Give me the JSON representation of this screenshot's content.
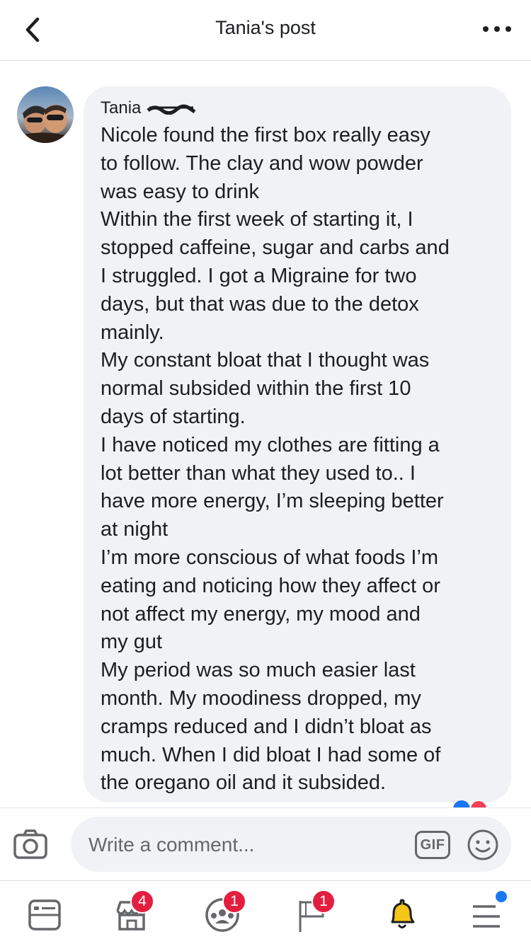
{
  "header": {
    "title": "Tania's post",
    "back_icon": "chevron-left-icon",
    "more_icon": "more-dots-icon"
  },
  "comment": {
    "author": "Tania",
    "lines": [
      "Nicole found the first box really easy",
      "to follow. The clay and wow powder",
      "was easy to drink",
      "Within the first week of starting it, I",
      "stopped caffeine, sugar and carbs and",
      "I struggled. I got a Migraine for two",
      "days, but that was due to the detox",
      "mainly.",
      "My constant bloat that I thought was",
      "normal subsided within the first 10",
      "days of starting.",
      "I have noticed my clothes are fitting a",
      "lot better than what they used to.. I",
      "have more energy, I’m sleeping better",
      "at night",
      "I’m more conscious of what foods I’m",
      "eating and noticing how they affect or",
      "not affect my energy, my mood and",
      "my gut",
      "My period was so much easier last",
      "month. My moodiness dropped, my",
      "cramps reduced and I didn’t bloat as",
      "much. When I did bloat I had some of",
      "the oregano oil and it subsided."
    ]
  },
  "comment_bar": {
    "placeholder": "Write a comment...",
    "gif_label": "GIF"
  },
  "nav": {
    "items": [
      {
        "name": "news-feed",
        "badge": ""
      },
      {
        "name": "marketplace",
        "badge": "4"
      },
      {
        "name": "groups",
        "badge": "1"
      },
      {
        "name": "pages",
        "badge": "1"
      },
      {
        "name": "notifications",
        "badge": ""
      },
      {
        "name": "menu",
        "badge": ""
      }
    ]
  },
  "colors": {
    "accent": "#1877f2",
    "badge": "#e41e3f",
    "bubble": "#f0f2f5"
  }
}
